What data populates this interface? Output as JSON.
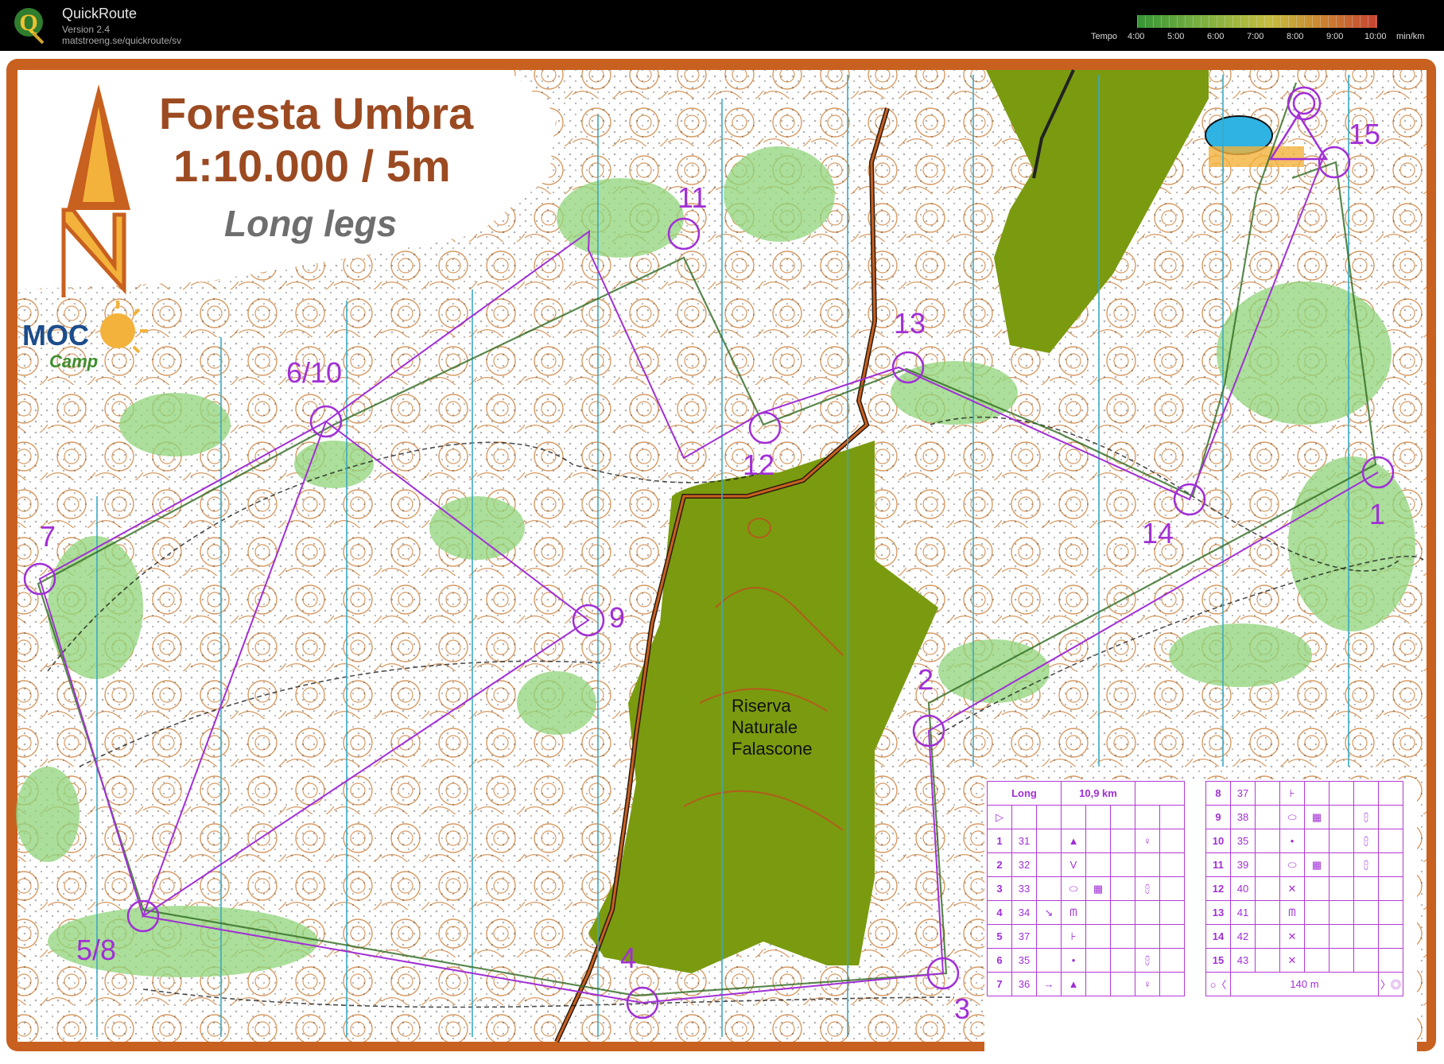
{
  "app": {
    "name": "QuickRoute",
    "version": "Version 2.4",
    "url": "matstroeng.se/quickroute/sv",
    "logo_letter": "Q"
  },
  "tempo_scale": {
    "label": "Tempo",
    "ticks": [
      "4:00",
      "5:00",
      "6:00",
      "7:00",
      "8:00",
      "9:00",
      "10:00"
    ],
    "unit": "min/km"
  },
  "map": {
    "title": "Foresta Umbra",
    "scale": "1:10.000 / 5m",
    "course": "Long legs",
    "logo_text": "MOC",
    "logo_subtext": "Camp",
    "reserve_lines": [
      "Riserva",
      "Naturale",
      "Falascone"
    ],
    "control_labels": [
      "1",
      "2",
      "3",
      "4",
      "5/8",
      "6/10",
      "7",
      "9",
      "11",
      "12",
      "13",
      "14",
      "15"
    ],
    "colors": {
      "frame": "#c8601f",
      "course": "#a12fd6",
      "vegetation": "#7a9b0f",
      "north_lines": "#3aa9c4"
    }
  },
  "descriptions": {
    "course_name": "Long",
    "length": "10,9 km",
    "rows_left": [
      {
        "num": "1",
        "code": "31"
      },
      {
        "num": "2",
        "code": "32"
      },
      {
        "num": "3",
        "code": "33"
      },
      {
        "num": "4",
        "code": "34"
      },
      {
        "num": "5",
        "code": "37"
      },
      {
        "num": "6",
        "code": "35"
      },
      {
        "num": "7",
        "code": "36"
      }
    ],
    "rows_right": [
      {
        "num": "8",
        "code": "37"
      },
      {
        "num": "9",
        "code": "38"
      },
      {
        "num": "10",
        "code": "35"
      },
      {
        "num": "11",
        "code": "39"
      },
      {
        "num": "12",
        "code": "40"
      },
      {
        "num": "13",
        "code": "41"
      },
      {
        "num": "14",
        "code": "42"
      },
      {
        "num": "15",
        "code": "43"
      }
    ],
    "finish_distance": "140 m"
  }
}
